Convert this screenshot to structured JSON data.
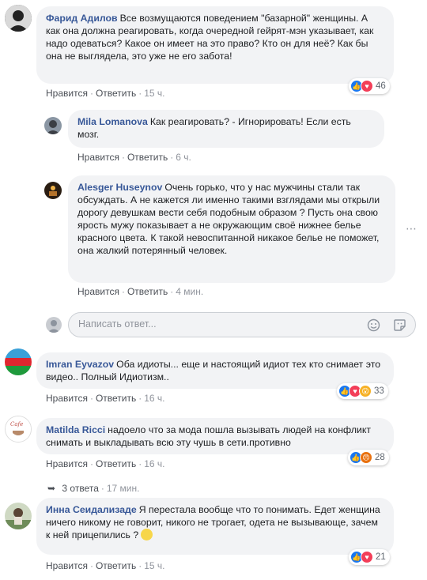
{
  "actions": {
    "like": "Нравится",
    "reply": "Ответить",
    "separator": "·"
  },
  "comments": [
    {
      "author": "Фарид Адилов",
      "text": "Все возмущаются поведением \"базарной\" женщины. А как она должна реагировать, когда очередной гейрят-мэн указывает, как надо одеваться? Какое он имеет на это право? Кто он для неё? Как бы она не выглядела, это уже не его забота!",
      "time": "15 ч.",
      "reactions": [
        "like",
        "love"
      ],
      "count": "46"
    },
    {
      "author": "Mila Lomanova",
      "text": "Как реагировать? - Игнорировать! Если есть мозг.",
      "time": "6 ч."
    },
    {
      "author": "Alesger Huseynov",
      "text": "Очень горько, что у нас мужчины стали так обсуждать. А не кажется ли именно такими взглядами мы открыли дорогу девушкам вести себя подобным образом ? Пусть она свою ярость мужу показывает а не окружающим своё нижнее белье красного цвета. К такой невоспитанной никакое белье не поможет, она жалкий потерянный человек.",
      "time": "4 мин."
    },
    {
      "author": "Imran Eyvazov",
      "text": "Оба идиоты... еще и настоящий идиот тех кто снимает это видео.. Полный Идиотизм..",
      "time": "16 ч.",
      "reactions": [
        "like",
        "love",
        "wow"
      ],
      "count": "33"
    },
    {
      "author": "Matilda Ricci",
      "text": "надоело что за мода пошла вызывать людей на конфликт снимать и выкладывать всю эту чушь в сети.противно",
      "time": "16 ч.",
      "reactions": [
        "like",
        "angry"
      ],
      "count": "28",
      "avatar_text": "Cafe"
    },
    {
      "author": "Инна Сеидализаде",
      "text": "Я перестала вообще что то понимать. Едет женщина ничего никому не говорит, никого не трогает, одета не вызывающе, зачем к ней прицепились ?",
      "time": "15 ч.",
      "reactions": [
        "like",
        "love"
      ],
      "count": "21"
    }
  ],
  "reply_input": {
    "placeholder": "Написать ответ..."
  },
  "replies_link": {
    "label": "3 ответа",
    "time": "17 мин."
  },
  "colors": {
    "link": "#385898",
    "bubble": "#f2f3f5",
    "like": "#1877f2",
    "love": "#f33e58"
  }
}
